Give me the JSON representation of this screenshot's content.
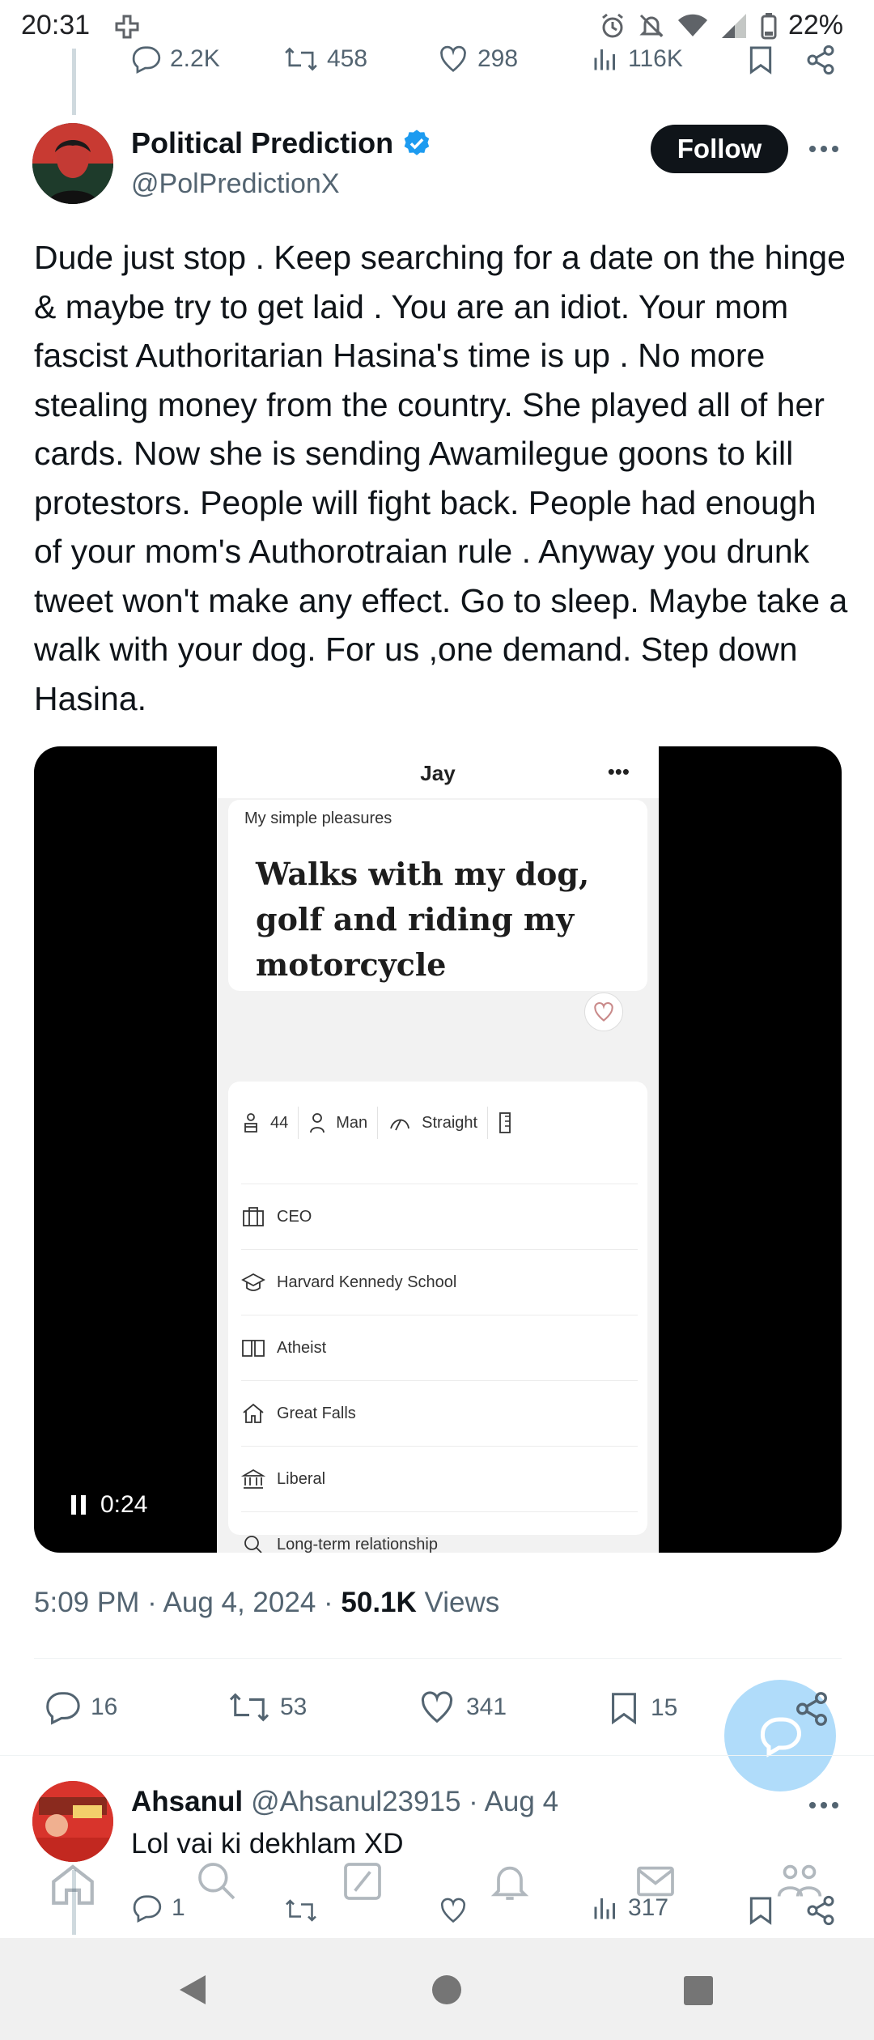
{
  "status_bar": {
    "time": "20:31",
    "battery": "22%"
  },
  "prev_tweet_actions": {
    "replies": "2.2K",
    "reposts": "458",
    "likes": "298",
    "views": "116K"
  },
  "tweet": {
    "author_name": "Political Prediction",
    "author_handle": "@PolPredictionX",
    "follow_label": "Follow",
    "text": "Dude just stop . Keep searching for a date on the hinge & maybe  try to get laid . You are an  idiot. Your mom fascist Authoritarian Hasina's time is up .  No more stealing money from the country. She played all of her cards.  Now she is sending  Awamilegue goons to kill protestors. People will fight back. People had enough of your mom's Authorotraian rule . Anyway you drunk tweet won't make any effect. Go to sleep. Maybe take a walk with your dog.  For us ,one demand. Step down Hasina.",
    "timestamp": "5:09 PM · Aug 4, 2024 · ",
    "views_count": "50.1K",
    "views_label": " Views",
    "replies": "16",
    "reposts": "53",
    "likes": "341",
    "bookmarks": "15"
  },
  "media": {
    "profile_name": "Jay",
    "prompt_label": "My simple pleasures",
    "prompt_answer": "Walks with my dog, golf and riding my motorcycle",
    "chips": [
      "44",
      "Man",
      "Straight"
    ],
    "info_rows": [
      {
        "icon": "briefcase-icon",
        "label": "CEO"
      },
      {
        "icon": "graduation-cap-icon",
        "label": "Harvard Kennedy School"
      },
      {
        "icon": "book-icon",
        "label": "Atheist"
      },
      {
        "icon": "home-icon",
        "label": "Great Falls"
      },
      {
        "icon": "bank-icon",
        "label": "Liberal"
      },
      {
        "icon": "search-icon",
        "label": "Long-term relationship"
      }
    ],
    "video_time": "0:24"
  },
  "reply": {
    "author_name": "Ahsanul",
    "meta": "@Ahsanul23915 · Aug 4",
    "text": "Lol vai ki dekhlam XD",
    "replies": "1",
    "views": "317"
  },
  "colors": {
    "accent": "#1d9bf0",
    "text_primary": "#0f1419",
    "text_secondary": "#536471",
    "verified": "#1d9bf0"
  }
}
